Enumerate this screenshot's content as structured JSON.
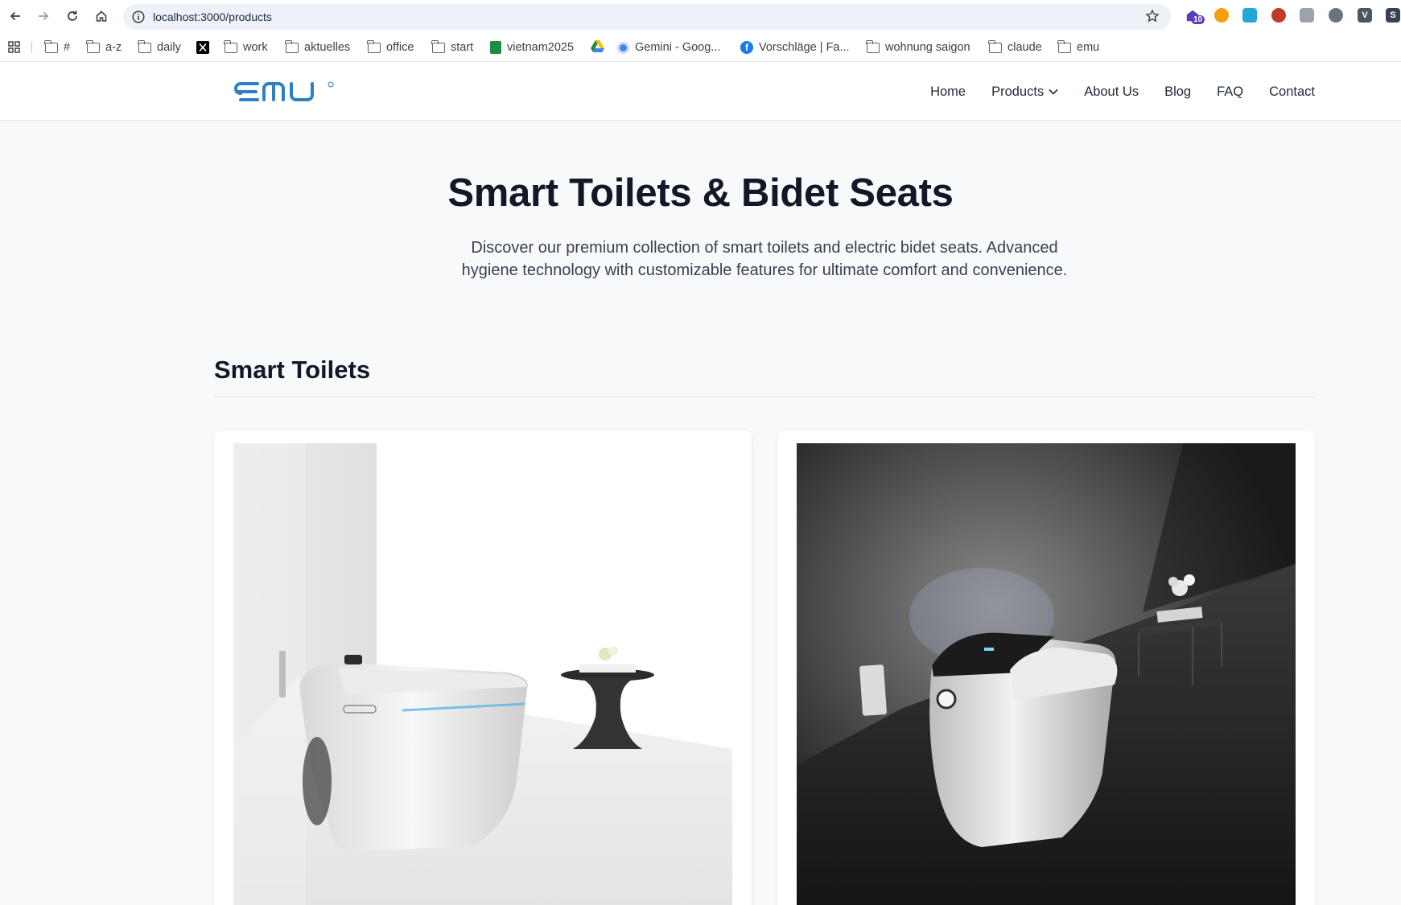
{
  "browser": {
    "url": "localhost:3000/products",
    "extension_badge": "10",
    "bookmarks": [
      {
        "label": "#",
        "icon": "folder-icon"
      },
      {
        "label": "a-z",
        "icon": "folder-icon"
      },
      {
        "label": "daily",
        "icon": "folder-icon"
      },
      {
        "label": "",
        "icon": "x-logo-icon"
      },
      {
        "label": "work",
        "icon": "folder-icon"
      },
      {
        "label": "aktuelles",
        "icon": "folder-icon"
      },
      {
        "label": "office",
        "icon": "folder-icon"
      },
      {
        "label": "start",
        "icon": "folder-icon"
      },
      {
        "label": "vietnam2025",
        "icon": "sheets-icon"
      },
      {
        "label": "",
        "icon": "drive-icon"
      },
      {
        "label": "Gemini - Goog...",
        "icon": "gemini-icon"
      },
      {
        "label": "Vorschläge | Fa...",
        "icon": "facebook-icon"
      },
      {
        "label": "wohnung saigon",
        "icon": "folder-icon"
      },
      {
        "label": "claude",
        "icon": "folder-icon"
      },
      {
        "label": "emu",
        "icon": "folder-icon"
      }
    ]
  },
  "site": {
    "brand_color": "#2f7fc1",
    "nav": {
      "home": "Home",
      "products": "Products",
      "about": "About Us",
      "blog": "Blog",
      "faq": "FAQ",
      "contact": "Contact"
    }
  },
  "hero": {
    "title": "Smart Toilets & Bidet Seats",
    "subtitle": "Discover our premium collection of smart toilets and electric bidet seats. Advanced hygiene technology with customizable features for ultimate comfort and convenience."
  },
  "section": {
    "title": "Smart Toilets"
  }
}
